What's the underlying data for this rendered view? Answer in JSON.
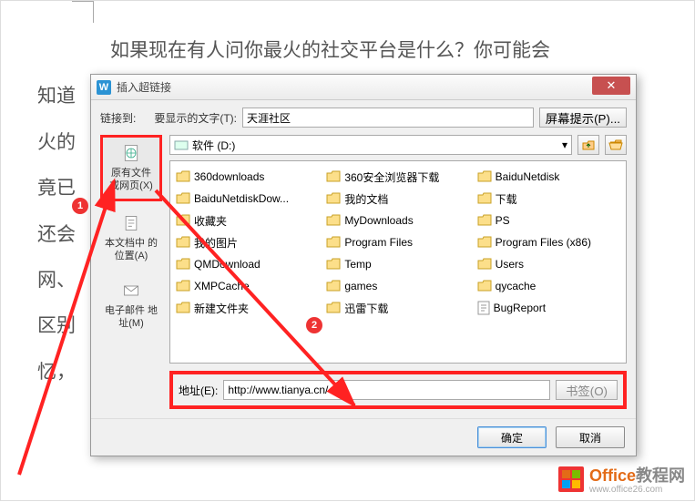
{
  "doc_lines": [
    "如果现在有人问你最火的社交平台是什么？你可能会",
    "知道",
    "火的",
    "竟已",
    "还会",
    "",
    "网、",
    "区别",
    "忆，"
  ],
  "dialog": {
    "title": "插入超链接",
    "link_to_label": "链接到:",
    "display_text_label": "要显示的文字(T):",
    "display_text_value": "天涯社区",
    "screen_tip_btn": "屏幕提示(P)..."
  },
  "sidebar": {
    "items": [
      {
        "label": "原有文件\n或网页(X)",
        "active": true
      },
      {
        "label": "本文档中\n的位置(A)",
        "active": false
      },
      {
        "label": "电子邮件\n地址(M)",
        "active": false
      }
    ]
  },
  "path": {
    "drive": "软件 (D:)"
  },
  "files": [
    {
      "name": "360downloads",
      "type": "folder"
    },
    {
      "name": "360安全浏览器下载",
      "type": "folder"
    },
    {
      "name": "BaiduNetdisk",
      "type": "folder"
    },
    {
      "name": "BaiduNetdiskDow...",
      "type": "folder"
    },
    {
      "name": "我的文档",
      "type": "folder"
    },
    {
      "name": "下载",
      "type": "folder"
    },
    {
      "name": "收藏夹",
      "type": "folder"
    },
    {
      "name": "MyDownloads",
      "type": "folder"
    },
    {
      "name": "PS",
      "type": "folder"
    },
    {
      "name": "我的图片",
      "type": "folder"
    },
    {
      "name": "Program Files",
      "type": "folder"
    },
    {
      "name": "Program Files (x86)",
      "type": "folder"
    },
    {
      "name": "QMDownload",
      "type": "folder"
    },
    {
      "name": "Temp",
      "type": "folder"
    },
    {
      "name": "Users",
      "type": "folder"
    },
    {
      "name": "XMPCache",
      "type": "folder"
    },
    {
      "name": "games",
      "type": "folder"
    },
    {
      "name": "qycache",
      "type": "folder"
    },
    {
      "name": "新建文件夹",
      "type": "folder"
    },
    {
      "name": "迅雷下载",
      "type": "folder"
    },
    {
      "name": "BugReport",
      "type": "file"
    }
  ],
  "address": {
    "label": "地址(E):",
    "value": "http://www.tianya.cn/",
    "bookmark_btn": "书签(O)"
  },
  "buttons": {
    "ok": "确定",
    "cancel": "取消"
  },
  "annotations": {
    "one": "1",
    "two": "2"
  },
  "watermark": {
    "brand": "Office",
    "suffix": "教程网",
    "url": "www.office26.com"
  },
  "colors": {
    "highlight": "#f22"
  }
}
